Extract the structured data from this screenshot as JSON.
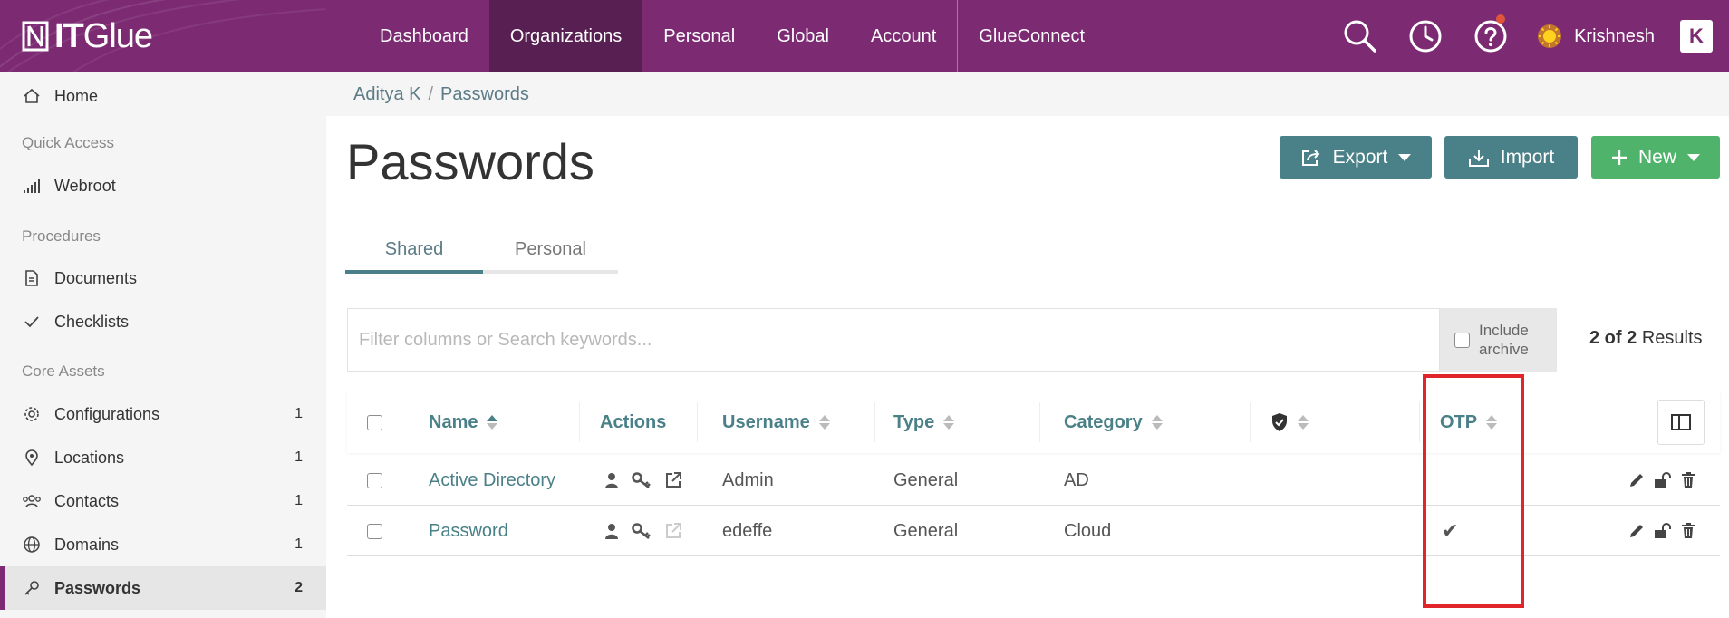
{
  "brand": {
    "logo_bold": "IT",
    "logo_thin": "Glue"
  },
  "colors": {
    "header": "#7c2b72",
    "header_active": "#581f52",
    "accent": "#4a8087",
    "new_button": "#50b36b",
    "highlight": "#e0252b"
  },
  "nav": {
    "items": [
      "Dashboard",
      "Organizations",
      "Personal",
      "Global",
      "Account",
      "GlueConnect"
    ],
    "active": "Organizations"
  },
  "topbar": {
    "icons": [
      "search-icon",
      "clock-icon",
      "help-icon"
    ],
    "user_name": "Krishnesh",
    "company_badge": "K"
  },
  "sidebar": {
    "home": "Home",
    "quick_access_heading": "Quick Access",
    "webroot": "Webroot",
    "procedures_heading": "Procedures",
    "documents": "Documents",
    "checklists": "Checklists",
    "core_assets_heading": "Core Assets",
    "configurations": {
      "label": "Configurations",
      "count": "1"
    },
    "locations": {
      "label": "Locations",
      "count": "1"
    },
    "contacts": {
      "label": "Contacts",
      "count": "1"
    },
    "domains": {
      "label": "Domains",
      "count": "1"
    },
    "passwords": {
      "label": "Passwords",
      "count": "2"
    }
  },
  "breadcrumb": {
    "org": "Aditya K",
    "separator": "/",
    "page": "Passwords"
  },
  "page": {
    "title": "Passwords"
  },
  "buttons": {
    "export": "Export",
    "import": "Import",
    "new": "New"
  },
  "tabs": {
    "shared": "Shared",
    "personal": "Personal",
    "active": "Shared"
  },
  "search": {
    "placeholder": "Filter columns or Search keywords...",
    "value": ""
  },
  "archive": {
    "label_line1": "Include",
    "label_line2": "archive",
    "checked": false
  },
  "results": {
    "count": "2 of 2",
    "label": "Results"
  },
  "table": {
    "columns": {
      "name": "Name",
      "actions": "Actions",
      "username": "Username",
      "type": "Type",
      "category": "Category",
      "security_icon": "shield-check-icon",
      "otp": "OTP"
    },
    "rows": [
      {
        "name": "Active Directory",
        "username": "Admin",
        "type": "General",
        "category": "AD",
        "otp": ""
      },
      {
        "name": "Password",
        "username": "edeffe",
        "type": "General",
        "category": "Cloud",
        "otp": "✔"
      }
    ]
  }
}
